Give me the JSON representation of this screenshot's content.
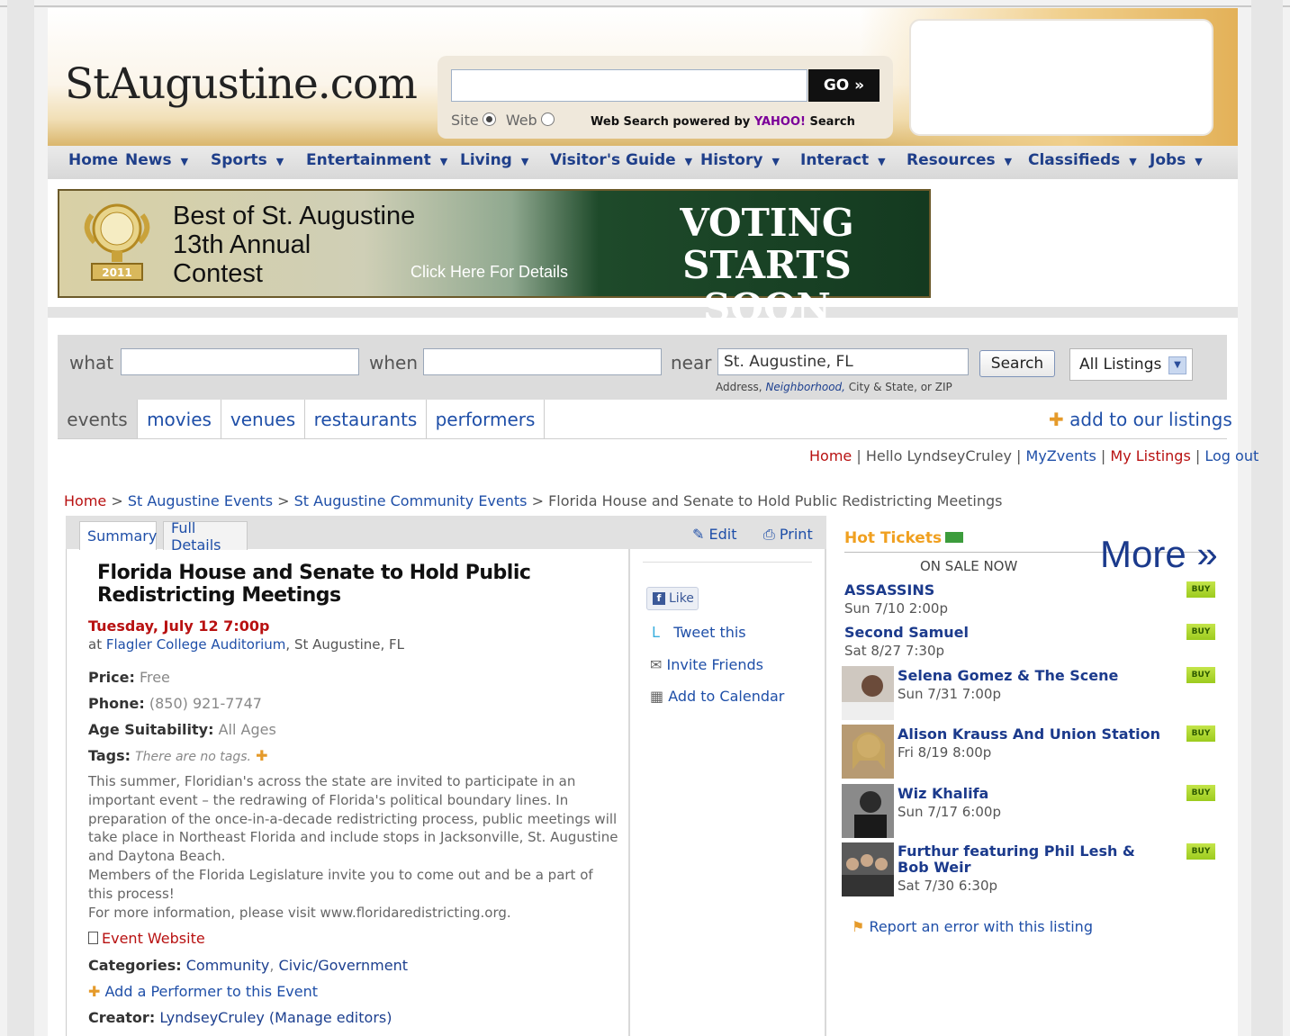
{
  "header": {
    "logo": "StAugustine.com",
    "search_placeholder": "",
    "go_label": "GO »",
    "radio_site": "Site",
    "radio_web": "Web",
    "powered_prefix": "Web Search powered by",
    "powered_brand": "YAHOO!",
    "powered_suffix": "Search"
  },
  "nav": {
    "items": [
      "Home",
      "News",
      "Sports",
      "Entertainment",
      "Living",
      "Visitor's Guide",
      "History",
      "Interact",
      "Resources",
      "Classifieds",
      "Jobs"
    ]
  },
  "banner": {
    "title_line1": "Best of St. Augustine",
    "title_line2": "13th Annual",
    "title_line3": "Contest",
    "click": "Click Here For Details",
    "voting_line1": "VOTING",
    "voting_line2": "STARTS SOON",
    "badge_year": "2011"
  },
  "search": {
    "what_label": "what",
    "when_label": "when",
    "near_label": "near",
    "near_value": "St. Augustine, FL",
    "hint_prefix": "Address,",
    "hint_neighborhood": "Neighborhood,",
    "hint_suffix": "City & State, or ZIP",
    "button": "Search",
    "select_value": "All Listings"
  },
  "tabs": {
    "items": [
      "events",
      "movies",
      "venues",
      "restaurants",
      "performers"
    ],
    "add_listings": "add to our listings"
  },
  "user_links": {
    "home": "Home",
    "hello": "Hello LyndseyCruley",
    "myzvents": "MyZvents",
    "my_listings": "My Listings",
    "logout": "Log out"
  },
  "breadcrumb": {
    "home": "Home",
    "events": "St Augustine Events",
    "community": "St Augustine Community Events",
    "current": "Florida House and Senate to Hold Public Redistricting Meetings"
  },
  "panel": {
    "tab_summary": "Summary",
    "tab_full": "Full Details",
    "edit": "Edit",
    "print": "Print"
  },
  "event": {
    "title_line1": "Florida House and Senate to Hold Public",
    "title_line2": "Redistricting Meetings",
    "date": "Tuesday, July 12 7:00p",
    "at_prefix": "at",
    "venue": "Flagler College Auditorium",
    "city": ", St Augustine, FL",
    "price_label": "Price:",
    "price": "Free",
    "phone_label": "Phone:",
    "phone": "(850) 921-7747",
    "age_label": "Age Suitability:",
    "age": "All Ages",
    "tags_label": "Tags:",
    "tags": "There are no tags.",
    "description_p1": "This summer, Floridian's across the state are invited to participate in an important event – the redrawing of Florida's political boundary lines. In preparation of the once-in-a-decade redistricting process, public meetings will take place in Northeast Florida and include stops in Jacksonville, St. Augustine and Daytona Beach.",
    "description_p2": "Members of the Florida Legislature invite you to come out and be a part of this process!",
    "description_p3": "For more information, please visit www.floridaredistricting.org.",
    "website": "Event Website",
    "categories_label": "Categories:",
    "category1": "Community",
    "category2": "Civic/Government",
    "add_performer": "Add a Performer to this Event",
    "creator_label": "Creator:",
    "creator": "LyndseyCruley",
    "manage": "(Manage editors)"
  },
  "social": {
    "like": "Like",
    "tweet": "Tweet this",
    "invite": "Invite Friends",
    "calendar": "Add to Calendar"
  },
  "tickets": {
    "heading": "Hot Tickets",
    "on_sale": "ON SALE NOW",
    "more": "More »",
    "buy": "BUY",
    "items": [
      {
        "name": "ASSASSINS",
        "date": "Sun 7/10 2:00p"
      },
      {
        "name": "Second Samuel",
        "date": "Sat 8/27 7:30p"
      },
      {
        "name": "Selena Gomez & The Scene",
        "date": "Sun 7/31 7:00p"
      },
      {
        "name": "Alison Krauss And Union Station",
        "date": "Fri 8/19 8:00p"
      },
      {
        "name": "Wiz Khalifa",
        "date": "Sun 7/17 6:00p"
      },
      {
        "name": "Furthur featuring Phil Lesh & Bob Weir",
        "date": "Sat 7/30 6:30p"
      }
    ],
    "report": "Report an error with this listing"
  }
}
